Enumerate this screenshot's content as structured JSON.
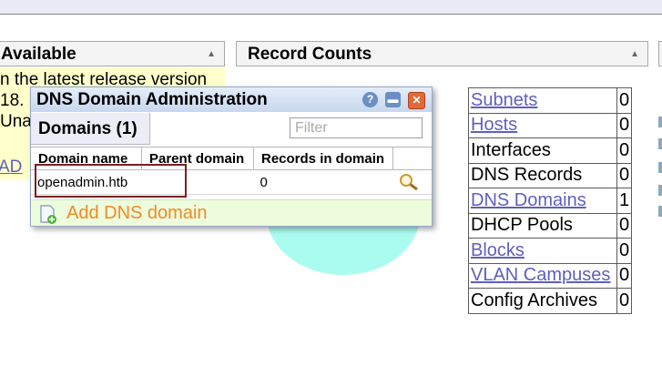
{
  "available": {
    "title": "Available",
    "lines": [
      "n the latest release version",
      "18.",
      "Unab"
    ],
    "link": "AD"
  },
  "record_counts": {
    "title": "Record Counts",
    "rows": [
      {
        "name": "Subnets",
        "count": "0",
        "link": true
      },
      {
        "name": "Hosts",
        "count": "0",
        "link": true
      },
      {
        "name": "Interfaces",
        "count": "0",
        "link": false
      },
      {
        "name": "DNS Records",
        "count": "0",
        "link": false
      },
      {
        "name": "DNS Domains",
        "count": "1",
        "link": true
      },
      {
        "name": "DHCP Pools",
        "count": "0",
        "link": false
      },
      {
        "name": "Blocks",
        "count": "0",
        "link": true
      },
      {
        "name": "VLAN Campuses",
        "count": "0",
        "link": true
      },
      {
        "name": "Config Archives",
        "count": "0",
        "link": false
      }
    ]
  },
  "window": {
    "title": "DNS Domain Administration",
    "tab": "Domains (1)",
    "filter_placeholder": "Filter",
    "columns": [
      "Domain name",
      "Parent domain",
      "Records in domain"
    ],
    "rows": [
      {
        "domain": "openadmin.htb",
        "parent": "",
        "records": "0"
      }
    ],
    "add_label": "Add DNS domain"
  },
  "colors": {
    "link": "#5f5fbf",
    "add_label": "#f08a24",
    "highlight_border": "#7a2020",
    "circle": "#aafcee"
  },
  "icons": [
    "help-icon",
    "minimize-icon",
    "close-icon",
    "magnifier-icon",
    "add-document-icon",
    "sort-up-icon"
  ]
}
